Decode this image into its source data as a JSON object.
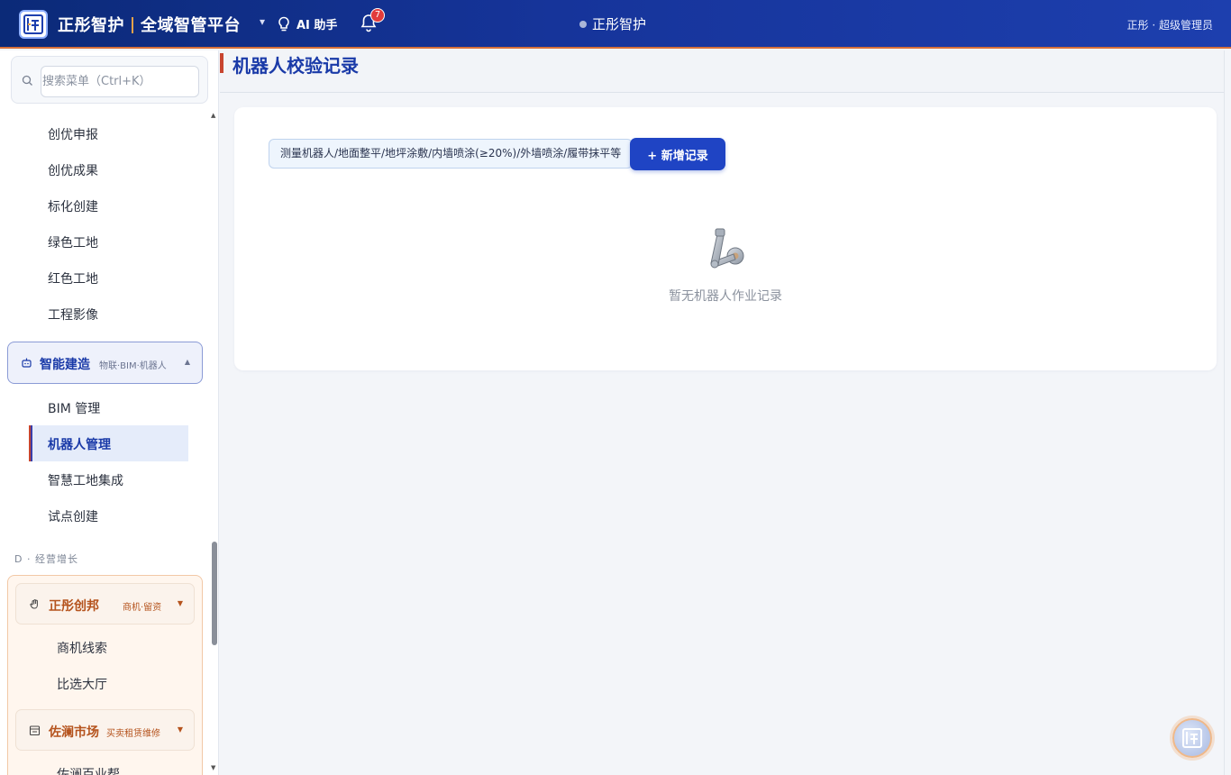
{
  "header": {
    "brand_name": "正彤智护",
    "platform_name": "全域智管平台",
    "caret": "▾",
    "ai_label": "AI 助手",
    "notification_count": "7",
    "center_title": "正彤智护",
    "user_text": "正彤 · 超级管理员"
  },
  "sidebar": {
    "search_placeholder": "搜索菜单（Ctrl+K）",
    "items": [
      "创优申报",
      "创优成果",
      "标化创建",
      "绿色工地",
      "红色工地",
      "工程影像"
    ],
    "group": {
      "title": "智能建造",
      "subtitle": "物联·BIM·机器人",
      "arrow": "▲"
    },
    "group_items": [
      "BIM 管理",
      "机器人管理",
      "智慧工地集成",
      "试点创建"
    ],
    "active_item": "机器人管理",
    "section_label": "D · 经营增长",
    "sub_groups": [
      {
        "title": "正彤创邦",
        "subtitle": "商机·留资",
        "arrow": "▼",
        "items": [
          "商机线索",
          "比选大厅"
        ]
      },
      {
        "title": "佐澜市场",
        "subtitle": "买卖租赁维修",
        "arrow": "▼",
        "items": [
          "佐澜百业帮"
        ]
      }
    ],
    "scroll_up": "▲",
    "scroll_down": "▼"
  },
  "main": {
    "page_title": "机器人校验记录",
    "filter_text": "测量机器人/地面整平/地坪涂敷/内墙喷涂(≥20%)/外墙喷涂/履带抹平等",
    "add_button": "+ 新增记录",
    "empty_icon": "robot-arm-icon",
    "empty_text": "暂无机器人作业记录"
  },
  "colors": {
    "header_bg": "#16349a",
    "accent": "#1f44c4",
    "accent_orange": "#c8452f",
    "orange_text": "#b5531d"
  }
}
